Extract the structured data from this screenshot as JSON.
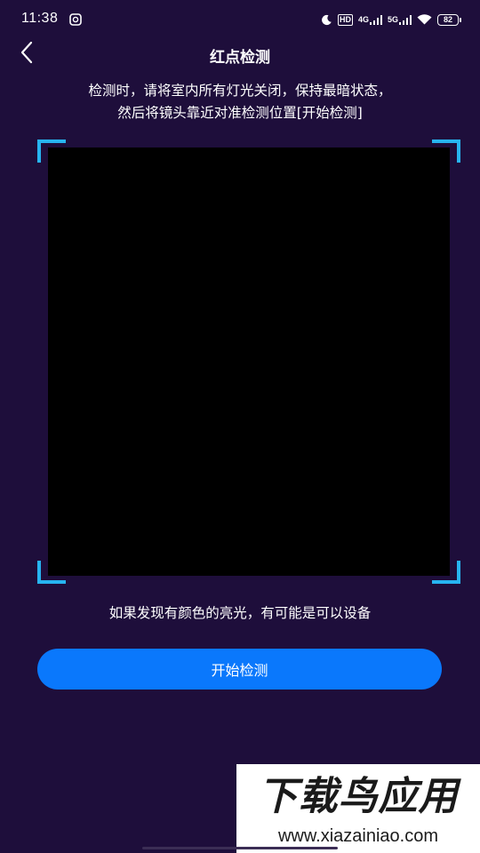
{
  "status_bar": {
    "time": "11:38",
    "app_icon": "app-notification-icon",
    "hd_label": "HD",
    "net1_label": "4G",
    "net2_label": "5G",
    "battery_level": "82",
    "icons": [
      "moon-icon",
      "hd-icon",
      "signal-4g-icon",
      "signal-5g-icon",
      "wifi-icon",
      "battery-icon"
    ]
  },
  "header": {
    "back_icon": "chevron-left-icon",
    "title": "红点检测"
  },
  "instructions": {
    "line1": "检测时，请将室内所有灯光关闭，保持最暗状态，",
    "line2": "然后将镜头靠近对准检测位置[开始检测]"
  },
  "camera": {
    "corner_color": "#27b4f0",
    "view_color": "#000000"
  },
  "hint": "如果发现有颜色的亮光，有可能是可以设备",
  "start_button": {
    "label": "开始检测",
    "color": "#0a78fc"
  },
  "watermark": {
    "title": "下载鸟应用",
    "url": "www.xiazainiao.com"
  },
  "colors": {
    "background": "#1e0e3b",
    "accent": "#0a78fc"
  }
}
